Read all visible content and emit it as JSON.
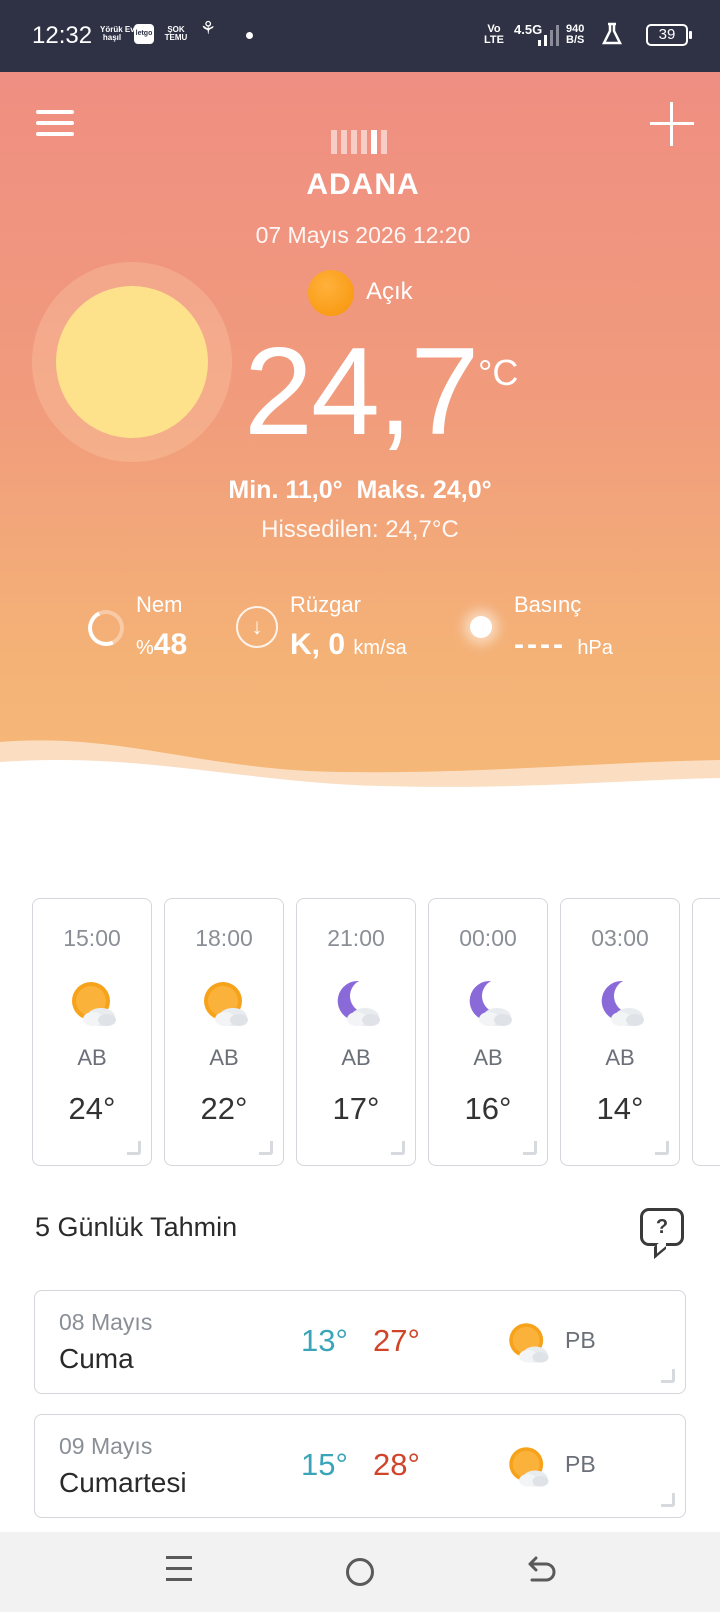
{
  "status_bar": {
    "time": "12:32",
    "notif_icons": [
      "Yörük Ev\nhaşıl",
      "letgo",
      "ŞOK\nTEMU",
      "wheat-icon"
    ],
    "network_volte": "Vo\nLTE",
    "network_type": "4.5G",
    "speed": "940\nB/S",
    "battery": "39"
  },
  "hero": {
    "city": "ADANA",
    "datetime": "07 Mayıs 2026 12:20",
    "condition": "Açık",
    "temperature": "24,7",
    "unit": "°C",
    "minmax": "Min. 11,0°  Maks. 24,0°",
    "feels_like": "Hissedilen: 24,7°C",
    "humidity": {
      "label": "Nem",
      "prefix": "%",
      "value": "48"
    },
    "wind": {
      "label": "Rüzgar",
      "value": "K, 0",
      "unit": "km/sa"
    },
    "pressure": {
      "label": "Basınç",
      "value": "----",
      "unit": "hPa"
    }
  },
  "hourly": [
    {
      "time": "15:00",
      "icon": "partly-sunny-icon",
      "dir": "AB",
      "temp": "24°"
    },
    {
      "time": "18:00",
      "icon": "partly-sunny-icon",
      "dir": "AB",
      "temp": "22°"
    },
    {
      "time": "21:00",
      "icon": "night-cloudy-icon",
      "dir": "AB",
      "temp": "17°"
    },
    {
      "time": "00:00",
      "icon": "night-cloudy-icon",
      "dir": "AB",
      "temp": "16°"
    },
    {
      "time": "03:00",
      "icon": "night-cloudy-icon",
      "dir": "AB",
      "temp": "14°"
    }
  ],
  "forecast": {
    "title": "5 Günlük Tahmin",
    "days": [
      {
        "date": "08 Mayıs",
        "day": "Cuma",
        "min": "13°",
        "max": "27°",
        "icon": "partly-sunny-icon",
        "dir": "PB"
      },
      {
        "date": "09 Mayıs",
        "day": "Cumartesi",
        "min": "15°",
        "max": "28°",
        "icon": "partly-sunny-icon",
        "dir": "PB"
      }
    ]
  },
  "colors": {
    "hero_top": "#ef8e82",
    "hero_bottom": "#f6ba79",
    "min_temp": "#3aa5b8",
    "max_temp": "#d0442a"
  }
}
